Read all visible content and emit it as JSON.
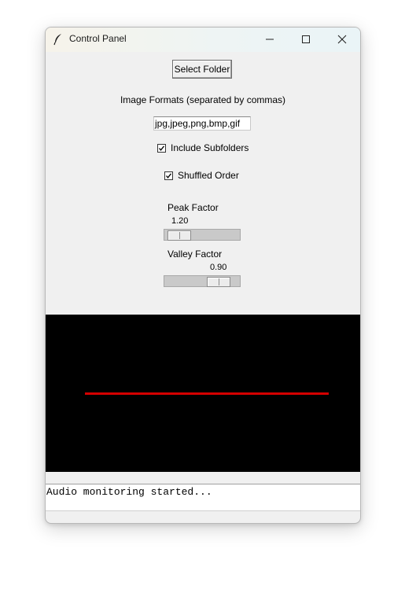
{
  "window": {
    "title": "Control Panel",
    "icon": "feather-icon"
  },
  "controls": {
    "select_folder_label": "Select Folder",
    "formats_label": "Image Formats (separated by commas)",
    "formats_value": "jpg,jpeg,png,bmp,gif",
    "include_subfolders": {
      "label": "Include Subfolders",
      "checked": true
    },
    "shuffled_order": {
      "label": "Shuffled Order",
      "checked": true
    }
  },
  "peak_factor": {
    "label": "Peak Factor",
    "value": "1.20"
  },
  "valley_factor": {
    "label": "Valley Factor",
    "value": "0.90"
  },
  "visualizer": {
    "background": "#000000",
    "line_color": "#d40000"
  },
  "log": {
    "text": "Audio monitoring started..."
  }
}
